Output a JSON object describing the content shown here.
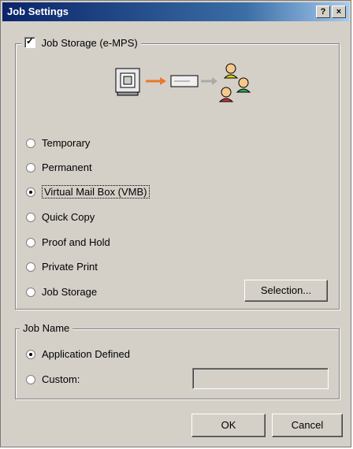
{
  "window": {
    "title": "Job Settings",
    "help_label": "?",
    "close_label": "×"
  },
  "job_storage_group": {
    "checkbox_label": "Job Storage (e-MPS)",
    "checked": true,
    "options": [
      {
        "label": "Temporary",
        "selected": false
      },
      {
        "label": "Permanent",
        "selected": false
      },
      {
        "label": "Virtual Mail Box (VMB)",
        "selected": true
      },
      {
        "label": "Quick Copy",
        "selected": false
      },
      {
        "label": "Proof and Hold",
        "selected": false
      },
      {
        "label": "Private Print",
        "selected": false
      },
      {
        "label": "Job Storage",
        "selected": false
      }
    ],
    "selection_button": "Selection..."
  },
  "job_name_group": {
    "title": "Job Name",
    "options": [
      {
        "label": "Application Defined",
        "selected": true
      },
      {
        "label": "Custom:",
        "selected": false
      }
    ],
    "custom_value": ""
  },
  "footer": {
    "ok_label": "OK",
    "cancel_label": "Cancel"
  },
  "colors": {
    "titlebar_start": "#0a246a",
    "dialog_bg": "#d4d0c8",
    "arrow": "#e8792a"
  }
}
